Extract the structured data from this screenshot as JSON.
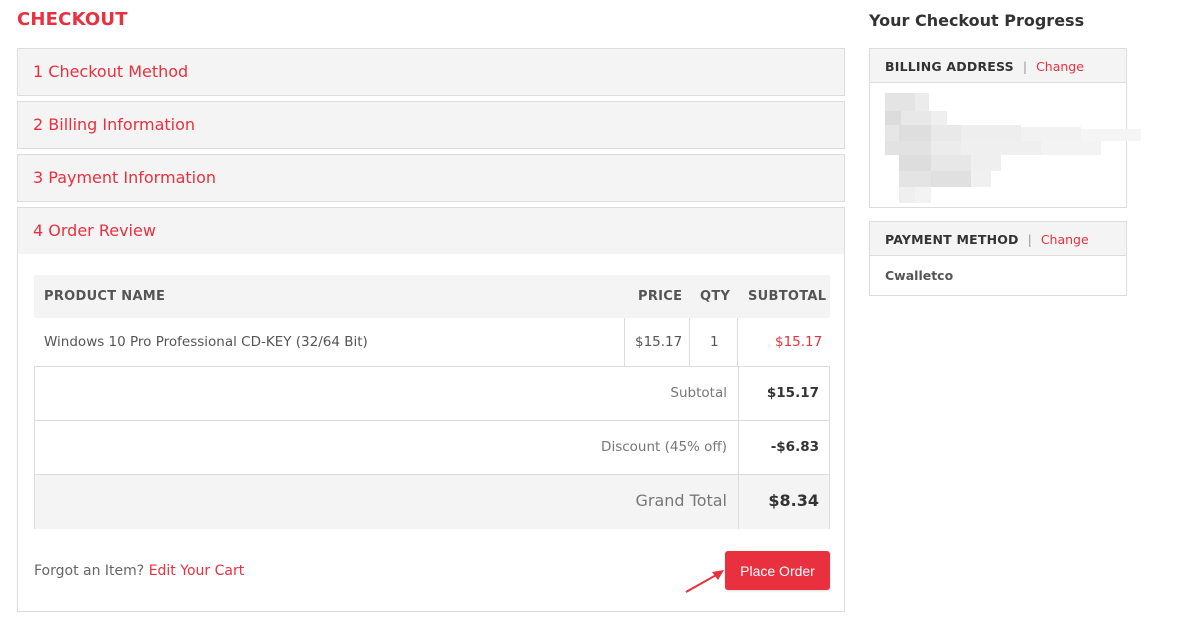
{
  "page": {
    "title": "CHECKOUT"
  },
  "steps": [
    {
      "label": "1 Checkout Method"
    },
    {
      "label": "2 Billing Information"
    },
    {
      "label": "3 Payment Information"
    },
    {
      "label": "4 Order Review"
    }
  ],
  "order_table": {
    "headers": [
      "PRODUCT NAME",
      "PRICE",
      "QTY",
      "SUBTOTAL"
    ],
    "rows": [
      {
        "name": "Windows 10 Pro Professional CD-KEY (32/64 Bit)",
        "price": "$15.17",
        "qty": "1",
        "subtotal": "$15.17"
      }
    ]
  },
  "totals": {
    "subtotal_label": "Subtotal",
    "subtotal_value": "$15.17",
    "discount_label": "Discount (45% off)",
    "discount_value": "-$6.83",
    "grand_label": "Grand Total",
    "grand_value": "$8.34"
  },
  "footer": {
    "forgot_text": "Forgot an Item?",
    "edit_cart_link": "Edit Your Cart",
    "place_order_label": "Place Order"
  },
  "progress": {
    "title": "Your Checkout Progress",
    "billing": {
      "heading": "BILLING ADDRESS",
      "separator": "|",
      "change_label": "Change"
    },
    "payment": {
      "heading": "PAYMENT METHOD",
      "separator": "|",
      "change_label": "Change",
      "value": "Cwalletco"
    }
  },
  "colors": {
    "accent": "#e8303f",
    "panel_bg": "#f4f4f4",
    "border": "#dcdcdc"
  }
}
